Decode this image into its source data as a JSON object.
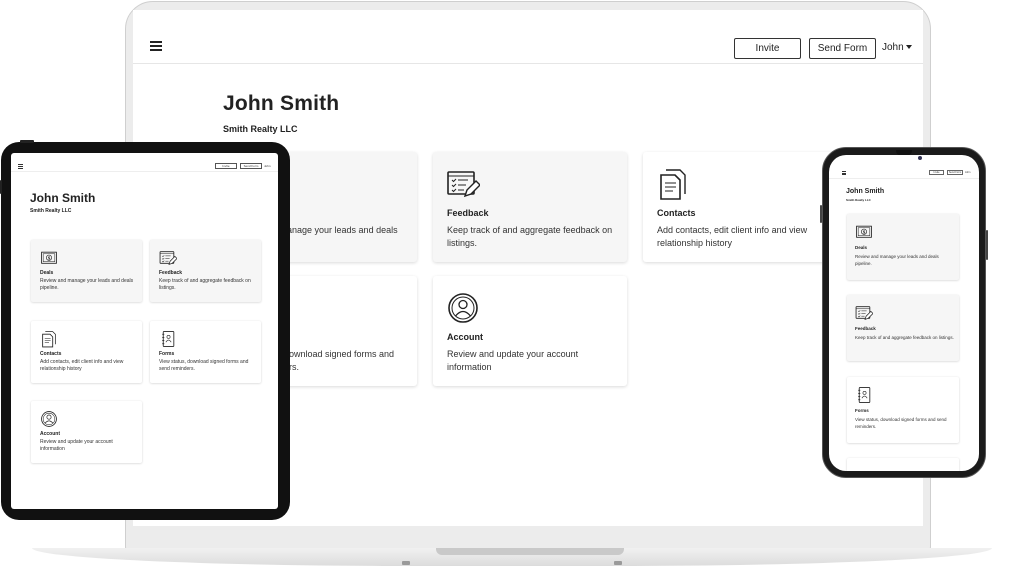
{
  "user": {
    "name": "John Smith",
    "company": "Smith Realty LLC",
    "menu_label": "John"
  },
  "header": {
    "invite_label": "Invite",
    "send_form_label": "Send Form"
  },
  "cards": [
    {
      "key": "deals",
      "title": "Deals",
      "description": "Review and manage your leads and deals pipeline.",
      "icon": "dollar-bill-icon"
    },
    {
      "key": "feedback",
      "title": "Feedback",
      "description": "Keep track of and aggregate feedback on listings.",
      "icon": "checklist-pencil-icon"
    },
    {
      "key": "contacts",
      "title": "Contacts",
      "description": "Add contacts, edit client info and view relationship history",
      "icon": "document-icon"
    },
    {
      "key": "forms",
      "title": "Forms",
      "description": "View status, download signed forms and send reminders.",
      "icon": "form-book-icon"
    },
    {
      "key": "account",
      "title": "Account",
      "description": "Review and update your account information",
      "icon": "user-circle-icon"
    }
  ],
  "laptop_fragments": {
    "deals_partial": "anage your leads and deals",
    "forms_partial_1": "ownload signed forms and",
    "forms_partial_2": "rs."
  },
  "colors": {
    "card_gray": "#f6f6f6",
    "text": "#222222",
    "device_dark": "#111111"
  }
}
